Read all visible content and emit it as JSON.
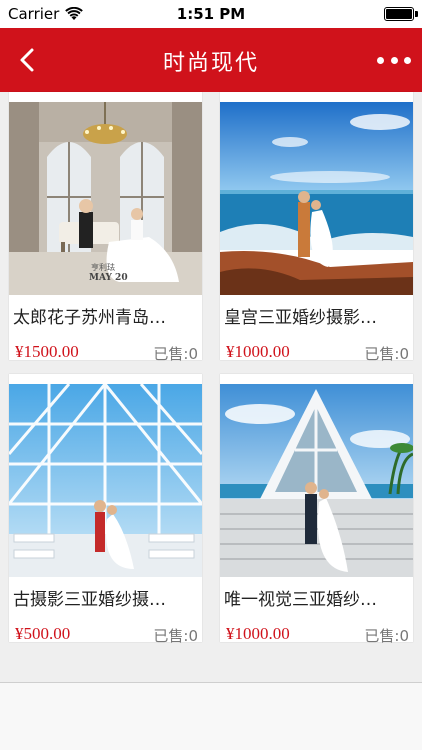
{
  "status": {
    "carrier": "Carrier",
    "time": "1:51 PM"
  },
  "nav": {
    "title": "时尚现代"
  },
  "products": [
    {
      "name": "太郎花子苏州青岛…",
      "price": "¥1500.00",
      "sold": "已售:0"
    },
    {
      "name": "皇宫三亚婚纱摄影…",
      "price": "¥1000.00",
      "sold": "已售:0"
    },
    {
      "name": "古摄影三亚婚纱摄…",
      "price": "¥500.00",
      "sold": "已售:0"
    },
    {
      "name": "唯一视觉三亚婚纱…",
      "price": "¥1000.00",
      "sold": "已售:0"
    }
  ],
  "photo_watermarks": [
    "亨利珐",
    "MAY 20"
  ],
  "theme": {
    "accent": "#d0121b",
    "price_color": "#d0121b"
  },
  "icons": {
    "back": "chevron-left-icon",
    "more": "more-dots-icon",
    "wifi": "wifi-icon",
    "battery": "battery-icon"
  }
}
